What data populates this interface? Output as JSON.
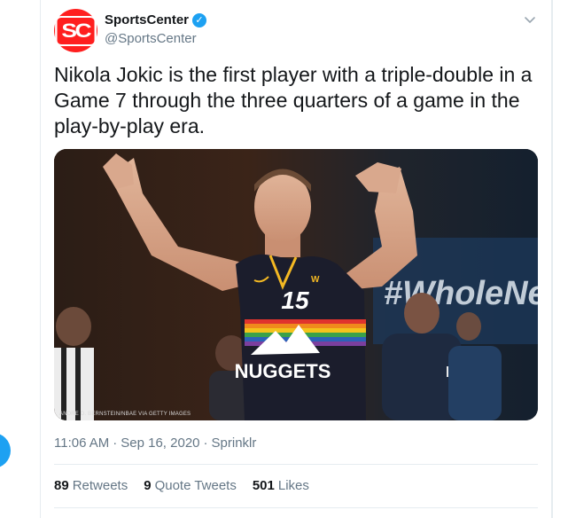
{
  "tweet": {
    "display_name": "SportsCenter",
    "handle": "@SportsCenter",
    "avatar_text": "SC",
    "verified_icon": "checkmark",
    "text": "Nikola Jokic is the first player with a triple-double in a Game 7 through the three quarters of a game in the play-by-play era.",
    "media": {
      "jersey_number": "15",
      "jersey_team": "NUGGETS",
      "background_text": "#WholeNew",
      "photo_credit": "ANDRE D. BERNSTEIN/NBAE VIA GETTY IMAGES"
    },
    "time": "11:06 AM",
    "date": "Sep 16, 2020",
    "source": "Sprinklr",
    "stats": {
      "retweets_count": "89",
      "retweets_label": "Retweets",
      "quotes_count": "9",
      "quotes_label": "Quote Tweets",
      "likes_count": "501",
      "likes_label": "Likes"
    }
  },
  "colors": {
    "brand_red": "#ff1f1f",
    "twitter_blue": "#1da1f2",
    "secondary_text": "#657786",
    "divider": "#e6ecf0"
  }
}
